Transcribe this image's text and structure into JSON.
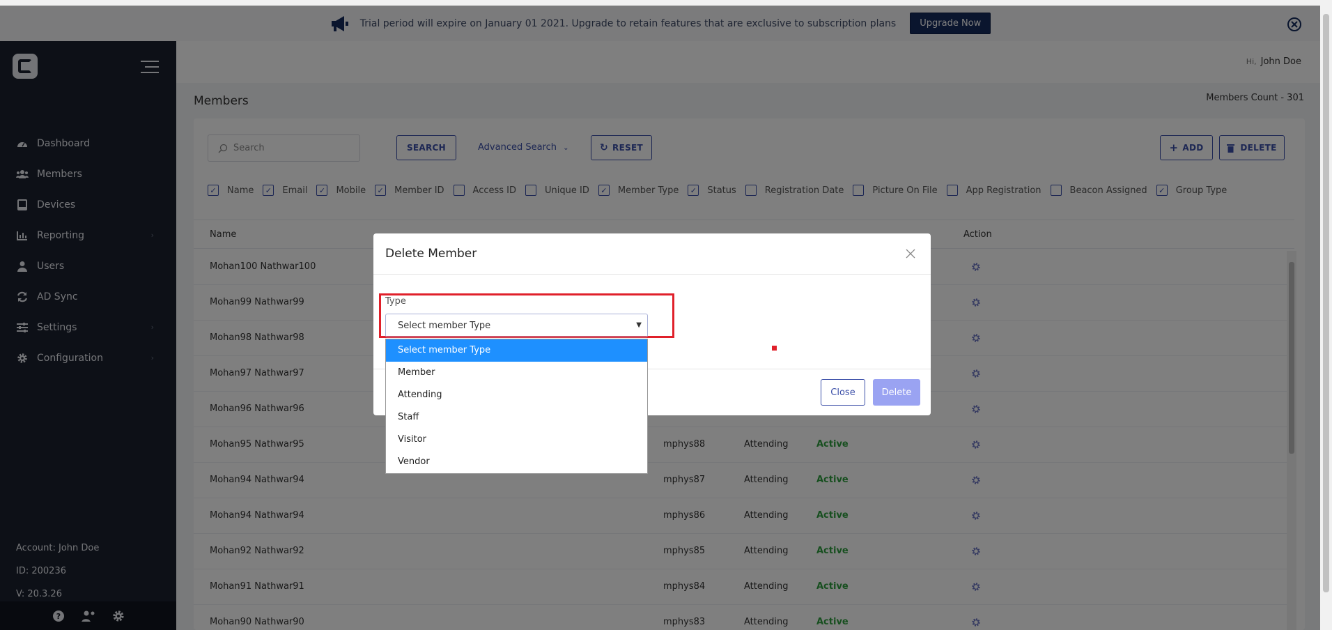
{
  "banner": {
    "message": "Trial period will expire on January 01 2021. Upgrade to retain features that are exclusive to subscription plans",
    "upgrade_label": "Upgrade Now"
  },
  "sidebar": {
    "items": [
      {
        "label": "Dashboard",
        "icon": "dashboard-icon"
      },
      {
        "label": "Members",
        "icon": "members-icon"
      },
      {
        "label": "Devices",
        "icon": "devices-icon"
      },
      {
        "label": "Reporting",
        "icon": "chart-icon",
        "has_submenu": true
      },
      {
        "label": "Users",
        "icon": "user-icon"
      },
      {
        "label": "AD Sync",
        "icon": "sync-icon"
      },
      {
        "label": "Settings",
        "icon": "sliders-icon",
        "has_submenu": true
      },
      {
        "label": "Configuration",
        "icon": "gear-icon",
        "has_submenu": true
      }
    ],
    "account": "Account: John Doe",
    "id": "ID: 200236",
    "version": "V: 20.3.26"
  },
  "header": {
    "greeting_prefix": "Hi,",
    "user_name": "John Doe"
  },
  "page": {
    "title": "Members",
    "count": "Members Count - 301"
  },
  "toolbar": {
    "search_placeholder": "Search",
    "search_label": "SEARCH",
    "advanced_label": "Advanced Search",
    "reset_label": "RESET",
    "add_label": "ADD",
    "delete_label": "DELETE"
  },
  "columns_filter": [
    {
      "label": "Name",
      "checked": true
    },
    {
      "label": "Email",
      "checked": true
    },
    {
      "label": "Mobile",
      "checked": true
    },
    {
      "label": "Member ID",
      "checked": true
    },
    {
      "label": "Access ID",
      "checked": false
    },
    {
      "label": "Unique ID",
      "checked": false
    },
    {
      "label": "Member Type",
      "checked": true
    },
    {
      "label": "Status",
      "checked": true
    },
    {
      "label": "Registration Date",
      "checked": false
    },
    {
      "label": "Picture On File",
      "checked": false
    },
    {
      "label": "App Registration",
      "checked": false
    },
    {
      "label": "Beacon Assigned",
      "checked": false
    },
    {
      "label": "Group Type",
      "checked": true
    }
  ],
  "table": {
    "headers": {
      "name": "Name",
      "action": "Action"
    },
    "rows": [
      {
        "name": "Mohan100 Nathwar100",
        "member_id": "",
        "type": "",
        "status": ""
      },
      {
        "name": "Mohan99 Nathwar99",
        "member_id": "",
        "type": "",
        "status": ""
      },
      {
        "name": "Mohan98 Nathwar98",
        "member_id": "",
        "type": "",
        "status": ""
      },
      {
        "name": "Mohan97 Nathwar97",
        "member_id": "",
        "type": "",
        "status": ""
      },
      {
        "name": "Mohan96 Nathwar96",
        "member_id": "",
        "type": "",
        "status": ""
      },
      {
        "name": "Mohan95 Nathwar95",
        "member_id": "mphys88",
        "type": "Attending",
        "status": "Active"
      },
      {
        "name": "Mohan94 Nathwar94",
        "member_id": "mphys87",
        "type": "Attending",
        "status": "Active"
      },
      {
        "name": "Mohan94 Nathwar94",
        "member_id": "mphys86",
        "type": "Attending",
        "status": "Active"
      },
      {
        "name": "Mohan92 Nathwar92",
        "member_id": "mphys85",
        "type": "Attending",
        "status": "Active"
      },
      {
        "name": "Mohan91 Nathwar91",
        "member_id": "mphys84",
        "type": "Attending",
        "status": "Active"
      },
      {
        "name": "Mohan90 Nathwar90",
        "member_id": "mphys83",
        "type": "Attending",
        "status": "Active"
      }
    ]
  },
  "modal": {
    "title": "Delete Member",
    "type_label": "Type",
    "select_value": "Select member Type",
    "options": [
      "Select member Type",
      "Member",
      "Attending",
      "Staff",
      "Visitor",
      "Vendor"
    ],
    "close_label": "Close",
    "delete_label": "Delete"
  },
  "colors": {
    "sidebar": "#1a202e",
    "accent": "#3b4fa8",
    "highlight": "#e0202a",
    "selected_option": "#1e90ff",
    "status_active": "#2e9e3e"
  }
}
